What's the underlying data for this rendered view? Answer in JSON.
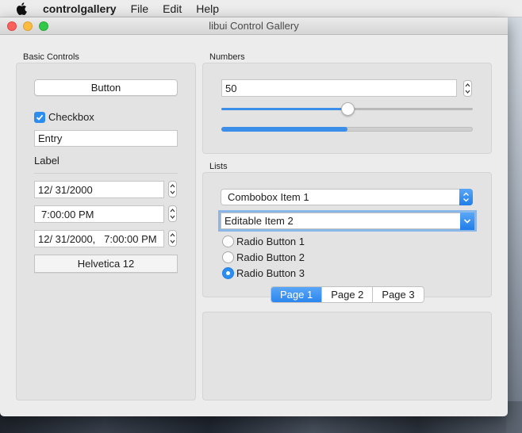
{
  "menubar": {
    "app_name": "controlgallery",
    "items": [
      "File",
      "Edit",
      "Help"
    ]
  },
  "window": {
    "title": "libui Control Gallery"
  },
  "basic_controls": {
    "group_label": "Basic Controls",
    "button_label": "Button",
    "checkbox_label": "Checkbox",
    "checkbox_checked": true,
    "entry_value": "Entry",
    "label_text": "Label",
    "date_value": "12/ 31/2000",
    "time_value": "7:00:00 PM",
    "datetime_value": "12/ 31/2000,   7:00:00 PM",
    "font_button_label": "Helvetica 12"
  },
  "numbers": {
    "group_label": "Numbers",
    "spinbox_value": "50",
    "slider_value": 50,
    "progress_value": 50
  },
  "lists": {
    "group_label": "Lists",
    "combobox_selected": "Combobox Item 1",
    "editable_combobox_value": "Editable Item 2",
    "radio_buttons": [
      {
        "label": "Radio Button 1",
        "selected": false
      },
      {
        "label": "Radio Button 2",
        "selected": false
      },
      {
        "label": "Radio Button 3",
        "selected": true
      }
    ]
  },
  "tabs": {
    "items": [
      "Page 1",
      "Page 2",
      "Page 3"
    ],
    "active_index": 0
  },
  "colors": {
    "accent": "#2d8cf0",
    "window_bg": "#ececec",
    "group_bg": "#e3e3e3"
  }
}
